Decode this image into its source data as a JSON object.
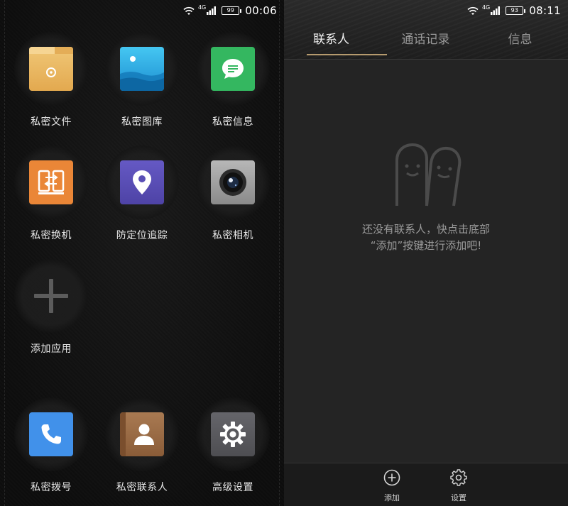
{
  "left_screen": {
    "status_bar": {
      "network": "4G",
      "battery": "99",
      "time": "00:06"
    },
    "apps": [
      {
        "label": "私密文件",
        "icon": "folder-icon",
        "color": "#e8b96a"
      },
      {
        "label": "私密图库",
        "icon": "gallery-icon",
        "color": "#29a6e0"
      },
      {
        "label": "私密信息",
        "icon": "message-icon",
        "color": "#34b760"
      },
      {
        "label": "私密换机",
        "icon": "phone-switch-icon",
        "color": "#e9853a"
      },
      {
        "label": "防定位追踪",
        "icon": "location-pin-icon",
        "color": "#5d52b8"
      },
      {
        "label": "私密相机",
        "icon": "camera-icon",
        "color": "#9a9a9a"
      },
      {
        "label": "添加应用",
        "icon": "plus-icon",
        "color": "#1e1e1e"
      },
      {
        "label": "私密拨号",
        "icon": "phone-icon",
        "color": "#3f8ee6"
      },
      {
        "label": "私密联系人",
        "icon": "contact-icon",
        "color": "#9b6a44"
      },
      {
        "label": "高级设置",
        "icon": "gear-icon",
        "color": "#5a5a5e"
      }
    ]
  },
  "right_screen": {
    "status_bar": {
      "network": "4G",
      "battery": "93",
      "time": "08:11"
    },
    "tabs": [
      {
        "label": "联系人",
        "active": true
      },
      {
        "label": "通话记录",
        "active": false
      },
      {
        "label": "信息",
        "active": false
      }
    ],
    "empty_state": {
      "line1": "还没有联系人，快点击底部",
      "line2": "“添加”按键进行添加吧!"
    },
    "bottom_bar": {
      "add_label": "添加",
      "settings_label": "设置"
    },
    "accent_color": "#b59a6e"
  }
}
